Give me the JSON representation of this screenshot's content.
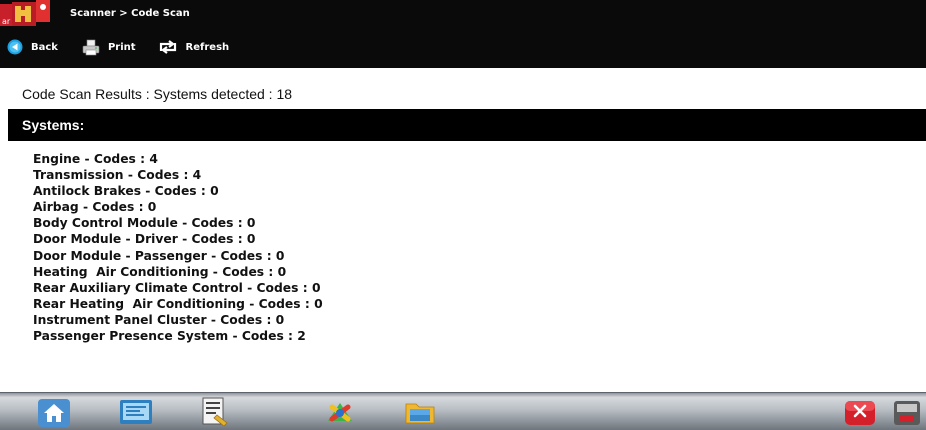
{
  "header": {
    "breadcrumb": "Scanner > Code Scan",
    "toolbar": {
      "back_label": "Back",
      "print_label": "Print",
      "refresh_label": "Refresh"
    }
  },
  "results": {
    "summary": "Code Scan Results : Systems detected : 18"
  },
  "systems": {
    "heading": "Systems:",
    "items": [
      "Engine - Codes : 4",
      "Transmission - Codes : 4",
      "Antilock Brakes - Codes : 0",
      "Airbag - Codes : 0",
      "Body Control Module - Codes : 0",
      "Door Module - Driver - Codes : 0",
      "Door Module - Passenger - Codes : 0",
      "Heating  Air Conditioning - Codes : 0",
      "Rear Auxiliary Climate Control - Codes : 0",
      "Rear Heating  Air Conditioning - Codes : 0",
      "Instrument Panel Cluster - Codes : 0",
      "Passenger Presence System - Codes : 2"
    ]
  },
  "taskbar": {
    "icons": [
      "home-icon",
      "scanner-icon",
      "document-icon",
      "tools-icon",
      "folder-icon",
      "exit-icon",
      "settings-icon"
    ]
  },
  "colors": {
    "header_bg": "#0a0a0a",
    "systems_header_bg": "#000000",
    "text": "#111111",
    "accent_red": "#d4202a"
  }
}
